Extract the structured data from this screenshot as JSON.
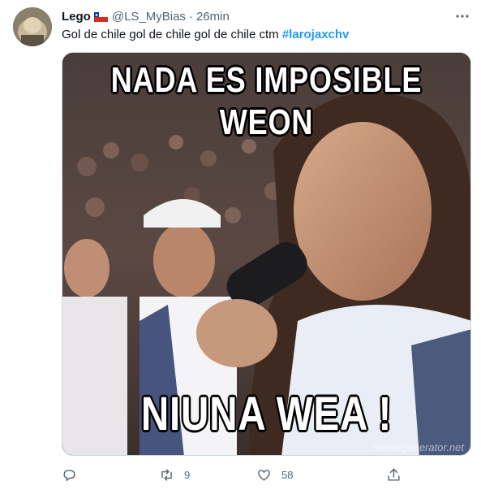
{
  "tweet": {
    "author_name": "Lego",
    "handle": "@LS_MyBias",
    "dot": "·",
    "time": "26min",
    "text_plain": "Gol de chile gol de chile gol de chile ctm ",
    "hashtag": "#larojaxchv",
    "meme": {
      "top_line1": "NADA ES IMPOSIBLE",
      "top_line2": "WEON",
      "bottom": "NIUNA WEA !",
      "watermark": "memegenerator.net"
    },
    "actions": {
      "reply_count": "",
      "retweet_count": "9",
      "like_count": "58"
    },
    "icons": {
      "reply": "reply-icon",
      "retweet": "retweet-icon",
      "like": "heart-icon",
      "share": "share-icon",
      "more": "more-icon",
      "flag": "chile-flag-icon"
    },
    "colors": {
      "text": "#0f1419",
      "secondary": "#536471",
      "link": "#1d9bf0"
    }
  }
}
